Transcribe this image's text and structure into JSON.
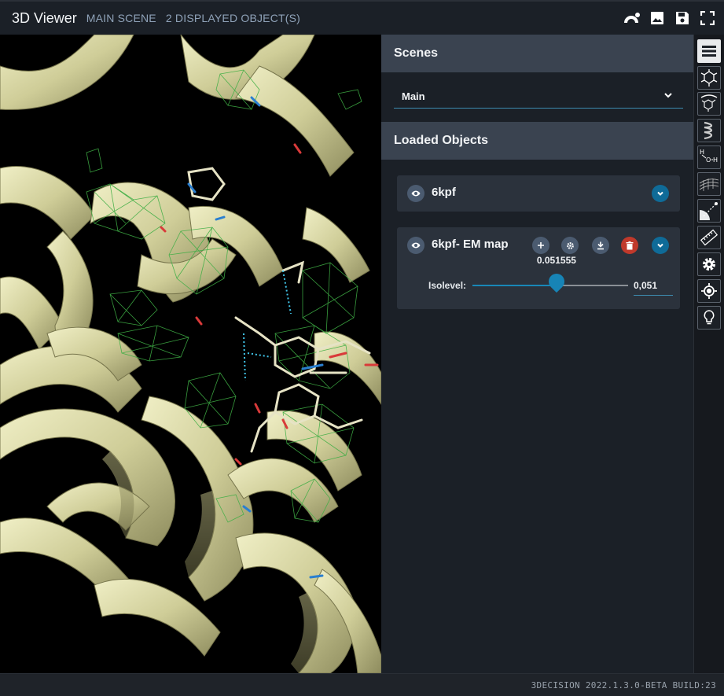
{
  "header": {
    "title": "3D Viewer",
    "scene": "MAIN SCENE",
    "objects": "2 DISPLAYED OBJECT(S)",
    "actions": [
      "rainbow-icon",
      "image-icon",
      "save-icon",
      "fullscreen-icon"
    ]
  },
  "scenes": {
    "heading": "Scenes",
    "selected": "Main"
  },
  "loaded_objects": {
    "heading": "Loaded Objects",
    "items": [
      {
        "name": "6kpf"
      },
      {
        "name": "6kpf- EM map",
        "isolevel_label": "Isolevel:",
        "isolevel_tooltip": "0.051555",
        "isolevel_input": "0,051",
        "isolevel_fraction": 0.54
      }
    ]
  },
  "toolbar": {
    "tools": [
      "menu-icon",
      "molecule-icon",
      "ligand-icon",
      "helix-icon",
      "water-icon",
      "surface-icon",
      "distance-icon",
      "ruler-icon",
      "settings-icon",
      "target-icon",
      "lightbulb-icon"
    ],
    "active": "menu-icon"
  },
  "footer": {
    "build": "3DECISION 2022.1.3.0-BETA BUILD:23"
  },
  "colors": {
    "ribbon": "#d8d6a6",
    "mesh": "#3fae45",
    "accent": "#1784b6",
    "delete": "#c0392b"
  }
}
